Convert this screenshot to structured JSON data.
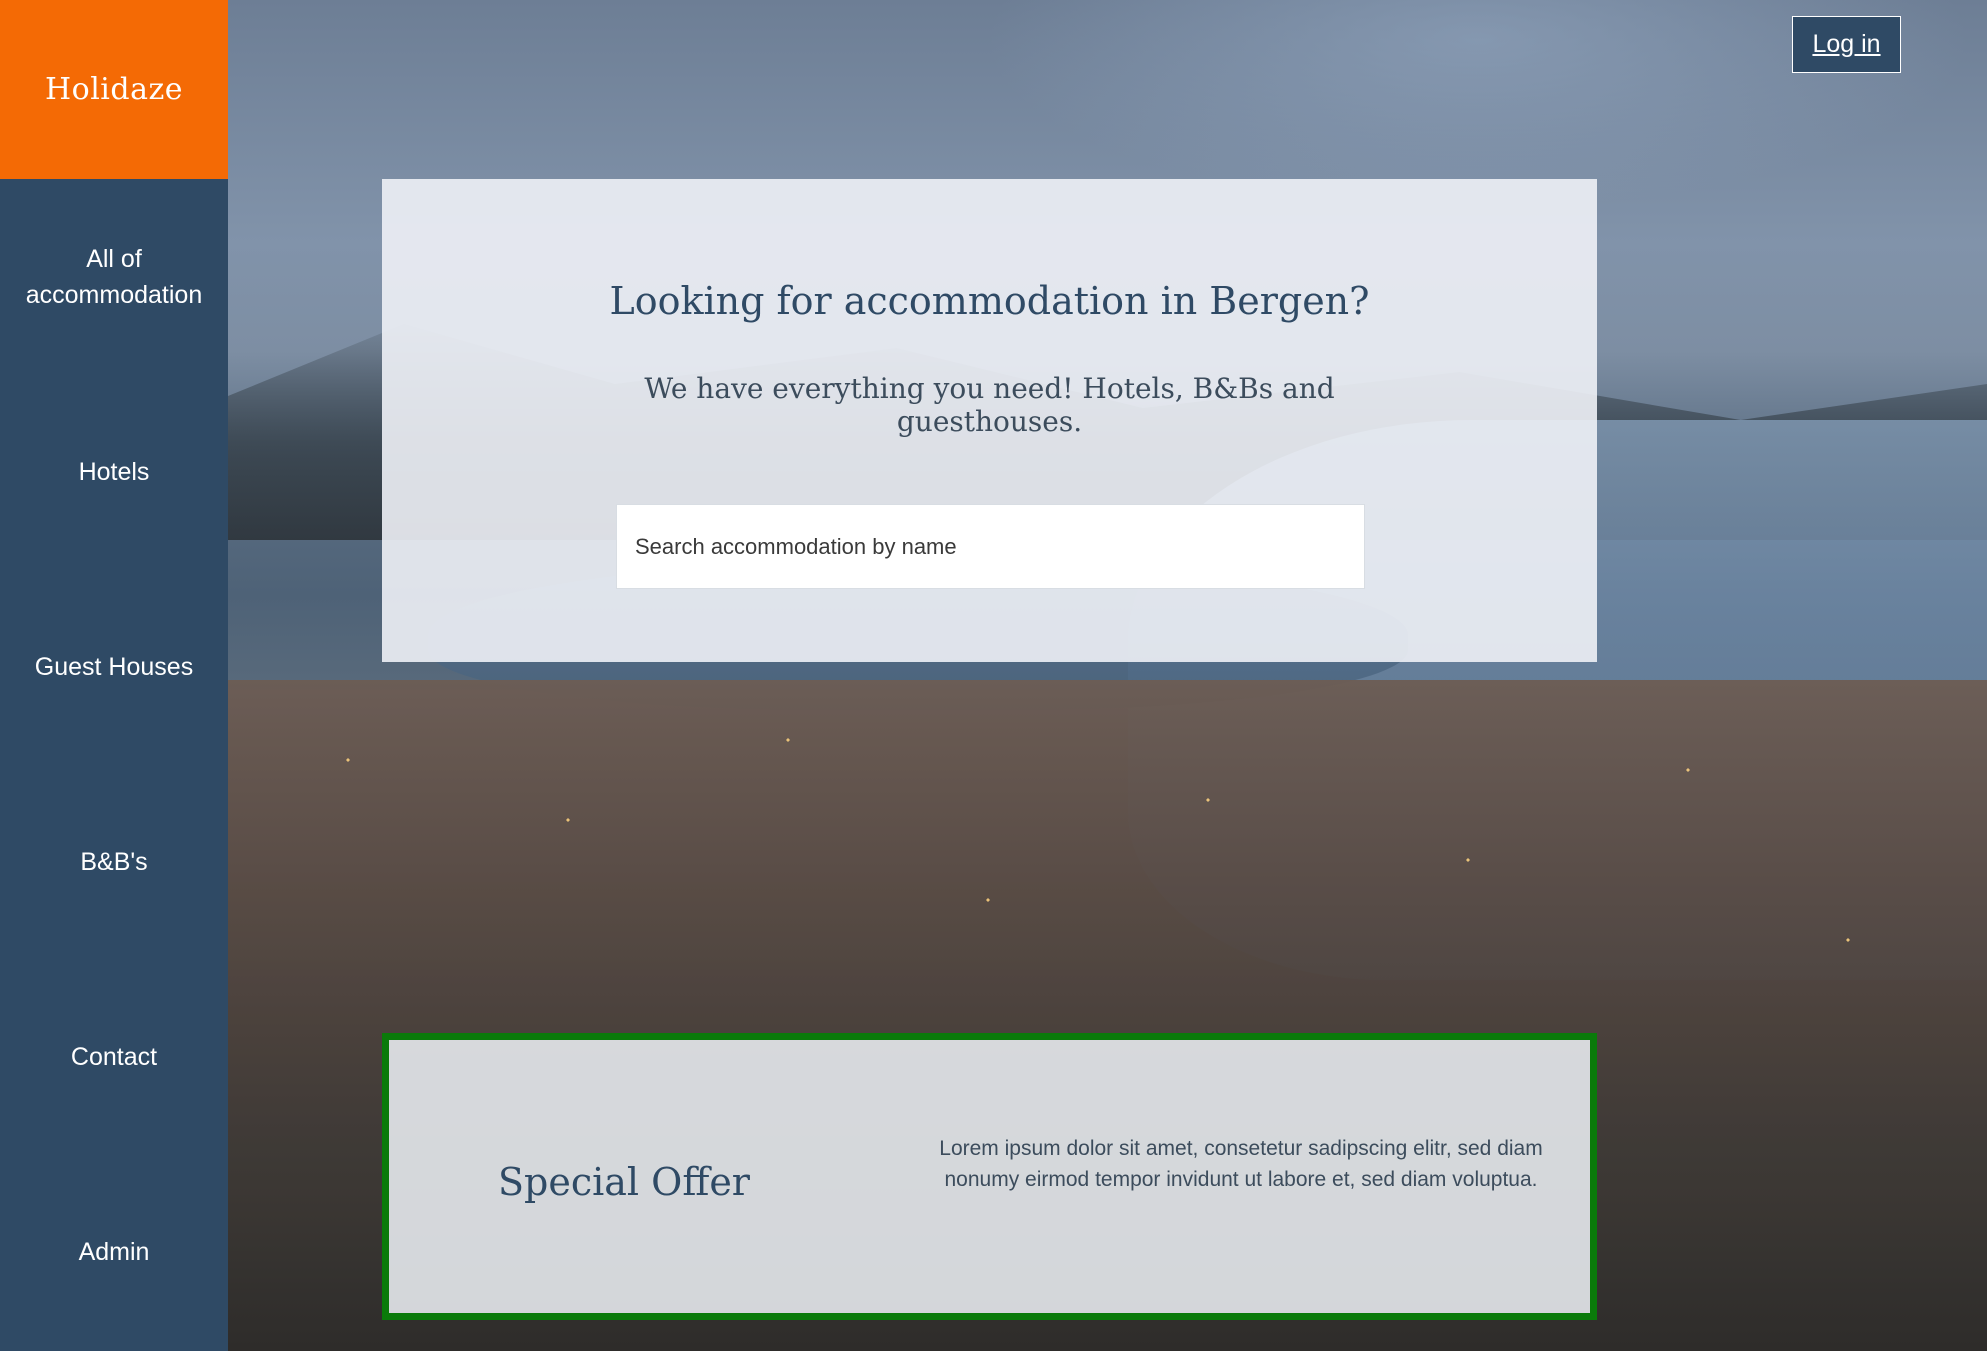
{
  "brand": {
    "name": "Holidaze"
  },
  "sidebar": {
    "items": [
      {
        "label": "All of accommodation"
      },
      {
        "label": "Hotels"
      },
      {
        "label": "Guest Houses"
      },
      {
        "label": "B&B's"
      },
      {
        "label": "Contact"
      },
      {
        "label": "Admin"
      }
    ]
  },
  "header": {
    "login_label": "Log in"
  },
  "hero": {
    "title": "Looking for accommodation in Bergen?",
    "subtitle": "We have everything you need! Hotels, B&Bs and guesthouses.",
    "search": {
      "placeholder": "Search accommodation by name",
      "value": ""
    }
  },
  "offer": {
    "title": "Special Offer",
    "text": "Lorem ipsum dolor sit amet, consetetur sadipscing elitr, sed diam nonumy eirmod tempor invidunt ut labore et, sed diam voluptua."
  },
  "colors": {
    "brand_orange": "#f46a05",
    "sidebar_navy": "#2f4a65",
    "offer_border_green": "#0a7a0a"
  }
}
